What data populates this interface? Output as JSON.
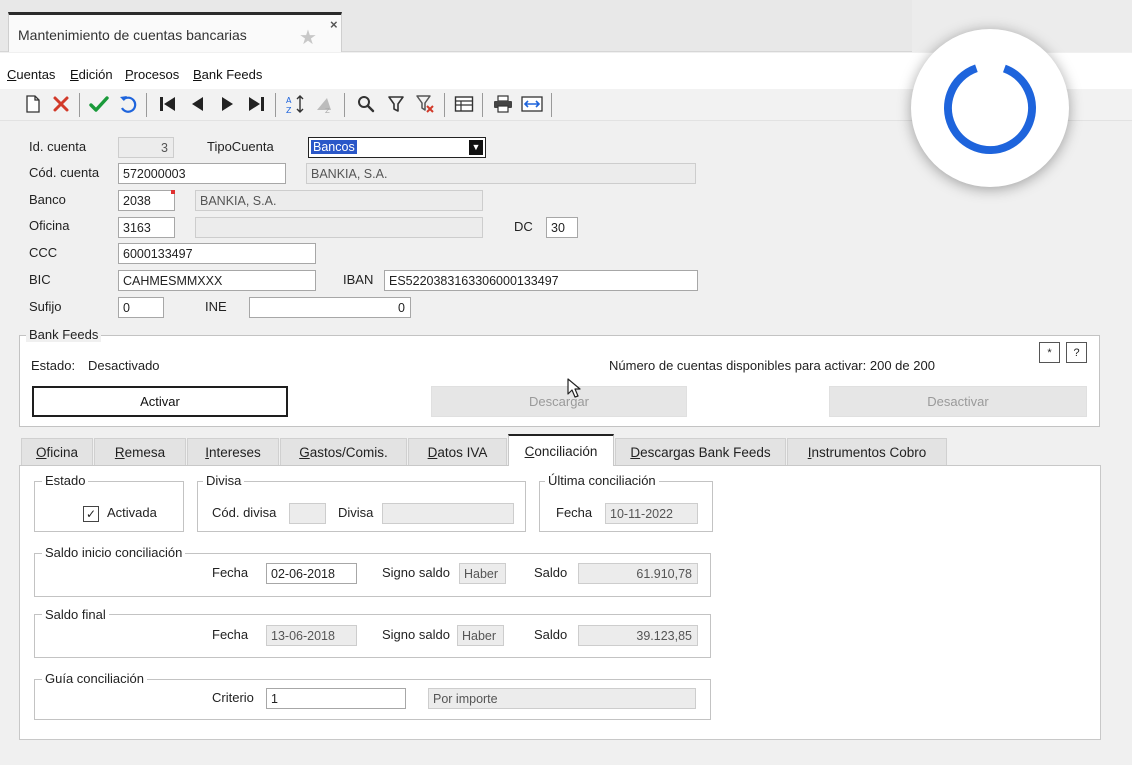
{
  "window": {
    "tab_title": "Mantenimiento de cuentas bancarias",
    "close_glyph": "×",
    "star_glyph": "★"
  },
  "menu": [
    "Cuentas",
    "Edición",
    "Procesos",
    "Bank Feeds"
  ],
  "toolbar_icons": [
    "new-icon",
    "delete-icon",
    "confirm-icon",
    "undo-icon",
    "first-record-icon",
    "previous-record-icon",
    "next-record-icon",
    "last-record-icon",
    "sort-icon",
    "sort-disabled-icon",
    "search-icon",
    "filter-icon",
    "clear-filter-icon",
    "table-view-icon",
    "print-icon",
    "export-icon"
  ],
  "form": {
    "id_cuenta": {
      "label": "Id. cuenta",
      "value": "3"
    },
    "tipo_cuenta": {
      "label": "TipoCuenta",
      "value": "Bancos"
    },
    "cod_cuenta": {
      "label": "Cód. cuenta",
      "value": "572000003",
      "desc": "BANKIA, S.A."
    },
    "banco": {
      "label": "Banco",
      "value": "2038",
      "desc": "BANKIA, S.A."
    },
    "oficina": {
      "label": "Oficina",
      "value": "3163",
      "desc": ""
    },
    "dc": {
      "label": "DC",
      "value": "30"
    },
    "ccc": {
      "label": "CCC",
      "value": "6000133497"
    },
    "bic": {
      "label": "BIC",
      "value": "CAHMESMMXXX"
    },
    "iban": {
      "label": "IBAN",
      "value": "ES5220383163306000133497"
    },
    "sufijo": {
      "label": "Sufijo",
      "value": "0"
    },
    "ine": {
      "label": "INE",
      "value": "0"
    }
  },
  "bank_feeds": {
    "title": "Bank Feeds",
    "estado_label": "Estado:",
    "estado_value": "Desactivado",
    "accounts_text": "Número de cuentas disponibles para activar: 200 de 200",
    "btn_activar": "Activar",
    "btn_descargar": "Descargar",
    "btn_desactivar": "Desactivar",
    "btn_star": "*",
    "btn_help": "?"
  },
  "tabs": [
    "Oficina",
    "Remesa",
    "Intereses",
    "Gastos/Comis.",
    "Datos IVA",
    "Conciliación",
    "Descargas Bank Feeds",
    "Instrumentos Cobro"
  ],
  "active_tab": "Conciliación",
  "conciliacion": {
    "estado": {
      "title": "Estado",
      "check_label": "Activada",
      "checked": true,
      "check_glyph": "✓"
    },
    "divisa": {
      "title": "Divisa",
      "cod_label": "Cód. divisa",
      "cod_value": "",
      "divisa_label": "Divisa",
      "divisa_value": ""
    },
    "ultima": {
      "title": "Última conciliación",
      "fecha_label": "Fecha",
      "fecha_value": "10-11-2022"
    },
    "saldo_inicio": {
      "title": "Saldo inicio conciliación",
      "fecha_label": "Fecha",
      "fecha_value": "02-06-2018",
      "signo_label": "Signo saldo",
      "signo_value": "Haber",
      "saldo_label": "Saldo",
      "saldo_value": "61.910,78"
    },
    "saldo_final": {
      "title": "Saldo final",
      "fecha_label": "Fecha",
      "fecha_value": "13-06-2018",
      "signo_label": "Signo saldo",
      "signo_value": "Haber",
      "saldo_label": "Saldo",
      "saldo_value": "39.123,85"
    },
    "guia": {
      "title": "Guía conciliación",
      "criterio_label": "Criterio",
      "criterio_value": "1",
      "criterio_desc": "Por importe"
    }
  },
  "colors": {
    "accent": "#1e64dc",
    "selection": "#2a57c8",
    "confirm": "#1a9a3a",
    "delete": "#d23a2a"
  }
}
